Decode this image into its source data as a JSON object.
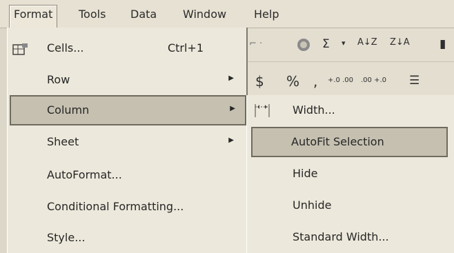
{
  "menubar": {
    "items": [
      {
        "label": "Format"
      },
      {
        "label": "Tools"
      },
      {
        "label": "Data"
      },
      {
        "label": "Window"
      },
      {
        "label": "Help"
      }
    ]
  },
  "toolbar": {
    "row1": [
      "Σ",
      "A↓Z",
      "Z↓A"
    ],
    "row2": [
      "$",
      "%",
      ",",
      "+.0 .00",
      ".00 +.0"
    ]
  },
  "format_menu": {
    "items": [
      {
        "label": "Cells...",
        "shortcut": "Ctrl+1",
        "icon": "cells-icon"
      },
      {
        "label": "Row",
        "submenu": true
      },
      {
        "label": "Column",
        "submenu": true,
        "highlighted": true
      },
      {
        "label": "Sheet",
        "submenu": true
      },
      {
        "label": "AutoFormat..."
      },
      {
        "label": "Conditional Formatting..."
      },
      {
        "label": "Style..."
      }
    ]
  },
  "column_submenu": {
    "items": [
      {
        "label": "Width...",
        "icon": "column-width-icon"
      },
      {
        "label": "AutoFit Selection",
        "highlighted": true
      },
      {
        "label": "Hide"
      },
      {
        "label": "Unhide"
      },
      {
        "label": "Standard Width..."
      }
    ]
  }
}
